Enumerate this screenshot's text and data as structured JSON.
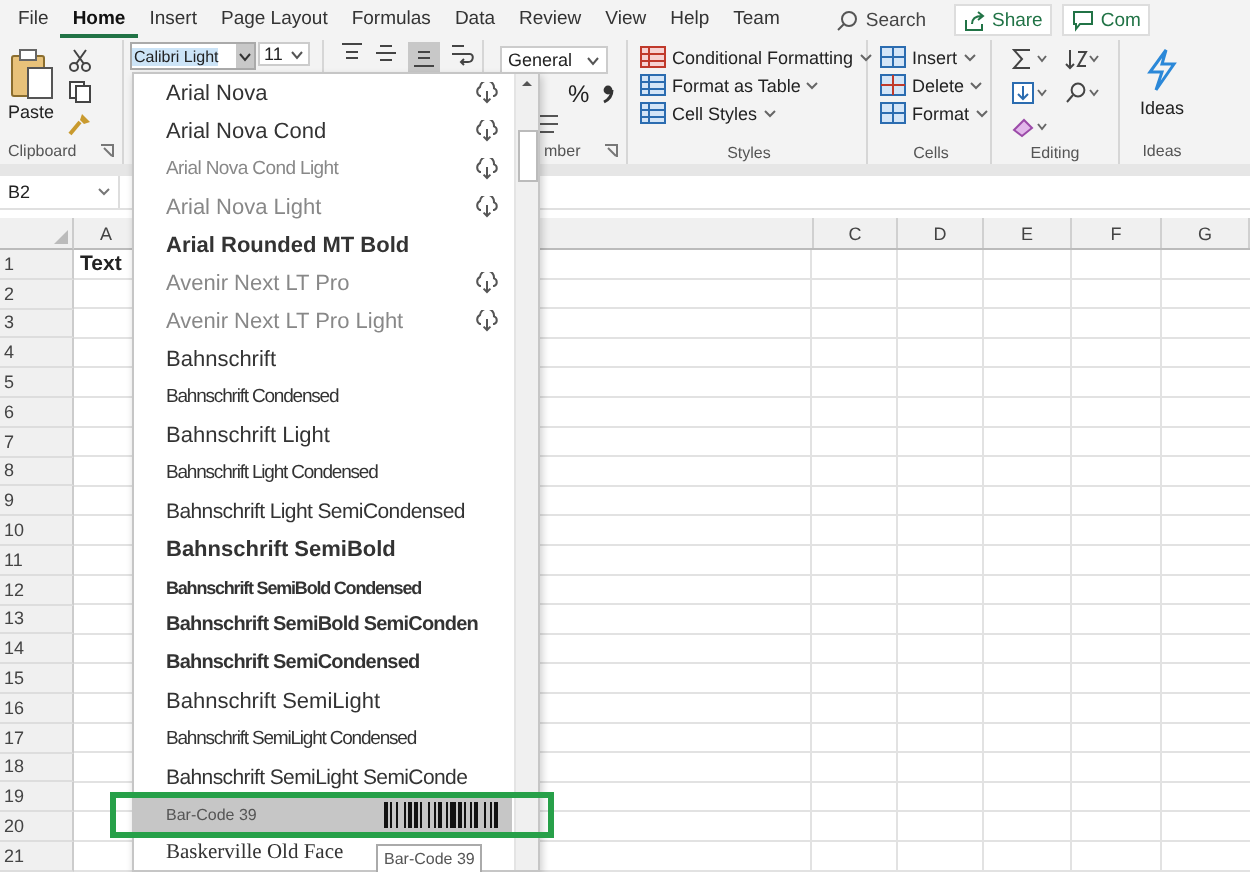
{
  "ribbon_tabs": [
    {
      "label": "File",
      "selected": false
    },
    {
      "label": "Home",
      "selected": true
    },
    {
      "label": "Insert",
      "selected": false
    },
    {
      "label": "Page Layout",
      "selected": false
    },
    {
      "label": "Formulas",
      "selected": false
    },
    {
      "label": "Data",
      "selected": false
    },
    {
      "label": "Review",
      "selected": false
    },
    {
      "label": "View",
      "selected": false
    },
    {
      "label": "Help",
      "selected": false
    },
    {
      "label": "Team",
      "selected": false
    }
  ],
  "search": {
    "label": "Search"
  },
  "share_button": "Share",
  "comments_button": "Com",
  "clipboard": {
    "paste": "Paste",
    "group": "Clipboard"
  },
  "font": {
    "name": "Calibri Light",
    "size": "11"
  },
  "number": {
    "format": "General",
    "percent": "%",
    "group": "mber"
  },
  "styles": {
    "items": [
      "Conditional Formatting",
      "Format as Table",
      "Cell Styles"
    ],
    "group": "Styles"
  },
  "cells": {
    "items": [
      "Insert",
      "Delete",
      "Format"
    ],
    "group": "Cells"
  },
  "editing": {
    "group": "Editing"
  },
  "ideas": {
    "label": "Ideas",
    "group": "Ideas"
  },
  "name_box": "B2",
  "columns": [
    "A",
    "C",
    "D",
    "E",
    "F",
    "G"
  ],
  "rows": [
    {
      "number": "1",
      "cell_a": "Text"
    },
    {
      "number": "2"
    },
    {
      "number": "3"
    },
    {
      "number": "4"
    },
    {
      "number": "5"
    },
    {
      "number": "6"
    },
    {
      "number": "7"
    },
    {
      "number": "8"
    },
    {
      "number": "9"
    },
    {
      "number": "10"
    },
    {
      "number": "11"
    },
    {
      "number": "12"
    },
    {
      "number": "13"
    },
    {
      "number": "14"
    },
    {
      "number": "15"
    },
    {
      "number": "16"
    },
    {
      "number": "17"
    },
    {
      "number": "18"
    },
    {
      "number": "19"
    },
    {
      "number": "20"
    },
    {
      "number": "21"
    }
  ],
  "font_list": [
    {
      "name": "Arial Nova",
      "kind": "regular",
      "cloud": true,
      "selected": false
    },
    {
      "name": "Arial Nova Cond",
      "kind": "regular",
      "cloud": true,
      "selected": false
    },
    {
      "name": "Arial Nova Cond Light",
      "kind": "light-condensed",
      "cloud": true,
      "selected": false
    },
    {
      "name": "Arial Nova Light",
      "kind": "light",
      "cloud": true,
      "selected": false
    },
    {
      "name": "Arial Rounded MT Bold",
      "kind": "bold",
      "cloud": false,
      "selected": false
    },
    {
      "name": "Avenir Next LT Pro",
      "kind": "light",
      "cloud": true,
      "selected": false
    },
    {
      "name": "Avenir Next LT Pro Light",
      "kind": "light",
      "cloud": true,
      "selected": false
    },
    {
      "name": "Bahnschrift",
      "kind": "regular",
      "cloud": false,
      "selected": false
    },
    {
      "name": "Bahnschrift Condensed",
      "kind": "condensed",
      "cloud": false,
      "selected": false
    },
    {
      "name": "Bahnschrift Light",
      "kind": "regular",
      "cloud": false,
      "selected": false
    },
    {
      "name": "Bahnschrift Light Condensed",
      "kind": "condensed",
      "cloud": false,
      "selected": false
    },
    {
      "name": "Bahnschrift Light SemiCondensed",
      "kind": "semicondensed",
      "cloud": false,
      "selected": false
    },
    {
      "name": "Bahnschrift SemiBold",
      "kind": "bold",
      "cloud": false,
      "selected": false
    },
    {
      "name": "Bahnschrift SemiBold Condensed",
      "kind": "bold-condensed",
      "cloud": false,
      "selected": false
    },
    {
      "name": "Bahnschrift SemiBold SemiConden",
      "kind": "bold-semicondensed",
      "cloud": false,
      "selected": false
    },
    {
      "name": "Bahnschrift SemiCondensed",
      "kind": "bold-semicondensed",
      "cloud": false,
      "selected": false
    },
    {
      "name": "Bahnschrift SemiLight",
      "kind": "regular",
      "cloud": false,
      "selected": false
    },
    {
      "name": "Bahnschrift SemiLight Condensed",
      "kind": "condensed",
      "cloud": false,
      "selected": false
    },
    {
      "name": "Bahnschrift SemiLight SemiConde",
      "kind": "semicondensed",
      "cloud": false,
      "selected": false
    },
    {
      "name": "Bar-Code 39",
      "kind": "barcode",
      "cloud": false,
      "selected": true
    },
    {
      "name": "Baskerville Old Face",
      "kind": "serif",
      "cloud": false,
      "selected": false
    }
  ],
  "tooltip": "Bar-Code 39"
}
